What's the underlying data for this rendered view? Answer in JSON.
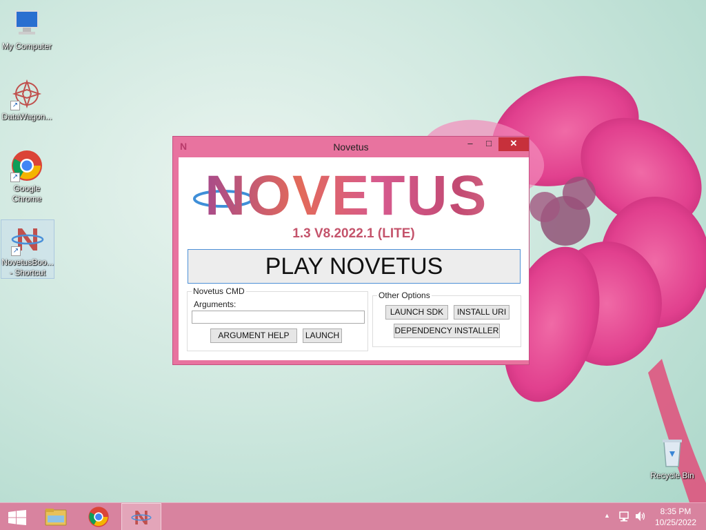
{
  "desktop": {
    "icons": [
      {
        "label": "My Computer",
        "icon": "computer-icon"
      },
      {
        "label": "DataWagon...",
        "icon": "datawagon-icon"
      },
      {
        "label": "Google Chrome",
        "icon": "chrome-icon"
      },
      {
        "label": "NovetusBoo... - Shortcut",
        "icon": "novetus-icon"
      },
      {
        "label": "Recycle Bin",
        "icon": "recycle-bin-icon"
      }
    ]
  },
  "window": {
    "title": "Novetus",
    "title_logo": "N",
    "controls": {
      "minimize": "–",
      "maximize": "□",
      "close": "✕"
    },
    "logo_text": "NOVETUS",
    "version": "1.3 V8.2022.1 (LITE)",
    "play_button": "PLAY NOVETUS",
    "cmd_group": {
      "title": "Novetus CMD",
      "arguments_label": "Arguments:",
      "arguments_value": "",
      "argument_help": "ARGUMENT HELP",
      "launch": "LAUNCH"
    },
    "options_group": {
      "title": "Other Options",
      "launch_sdk": "LAUNCH SDK",
      "install_uri": "INSTALL URI",
      "dependency_installer": "DEPENDENCY INSTALLER"
    }
  },
  "taskbar": {
    "items": [
      "start-icon",
      "file-explorer-icon",
      "chrome-icon",
      "novetus-icon"
    ],
    "tray_up": "▲",
    "clock_time": "8:35 PM",
    "clock_date": "10/25/2022"
  },
  "colors": {
    "window_frame": "#e8739f",
    "taskbar": "#d8839f",
    "close_button": "#c7303b",
    "version_text": "#c4536b",
    "play_button_border": "#4c8fd6"
  }
}
